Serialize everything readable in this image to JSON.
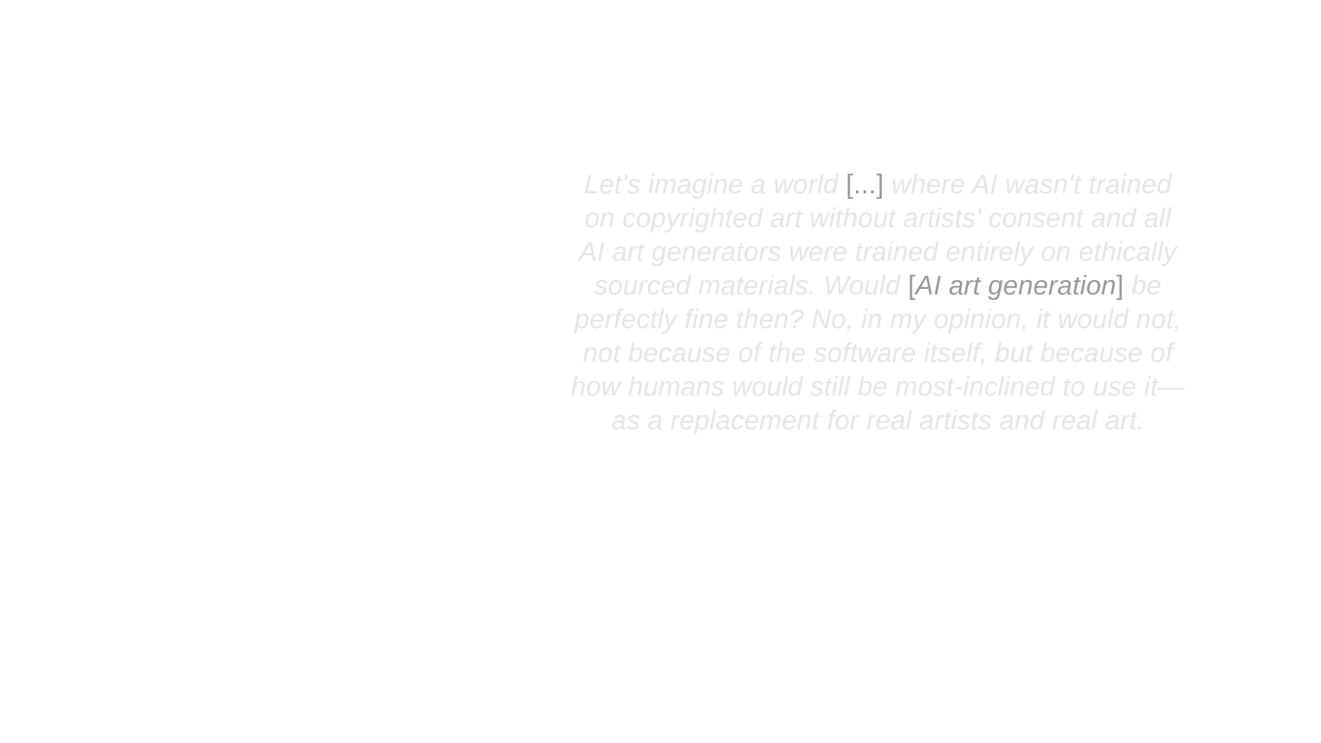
{
  "quote": {
    "l1": {
      "a": "Let's imagine a world ",
      "open": "[",
      "ellipsis": "...",
      "close": "]",
      "b": " where AI wasn't trained"
    },
    "l2": "on copyrighted art without artists' consent and all",
    "l3": "AI art generators were trained entirely on ethically",
    "l4": {
      "a": "sourced materials. Would ",
      "open": "[",
      "insert": "AI art generation",
      "close": "]",
      "b": " be"
    },
    "l5": "perfectly fine then? No, in my opinion, it would not,",
    "l6": "not because of the software itself, but because of",
    "l7": "how humans would still be most-inclined to use it—",
    "l8": "as a replacement for real artists and real art."
  },
  "colors": {
    "text": "#e6e6e6",
    "insertion": "#9a9a9a",
    "background": "#ffffff"
  }
}
